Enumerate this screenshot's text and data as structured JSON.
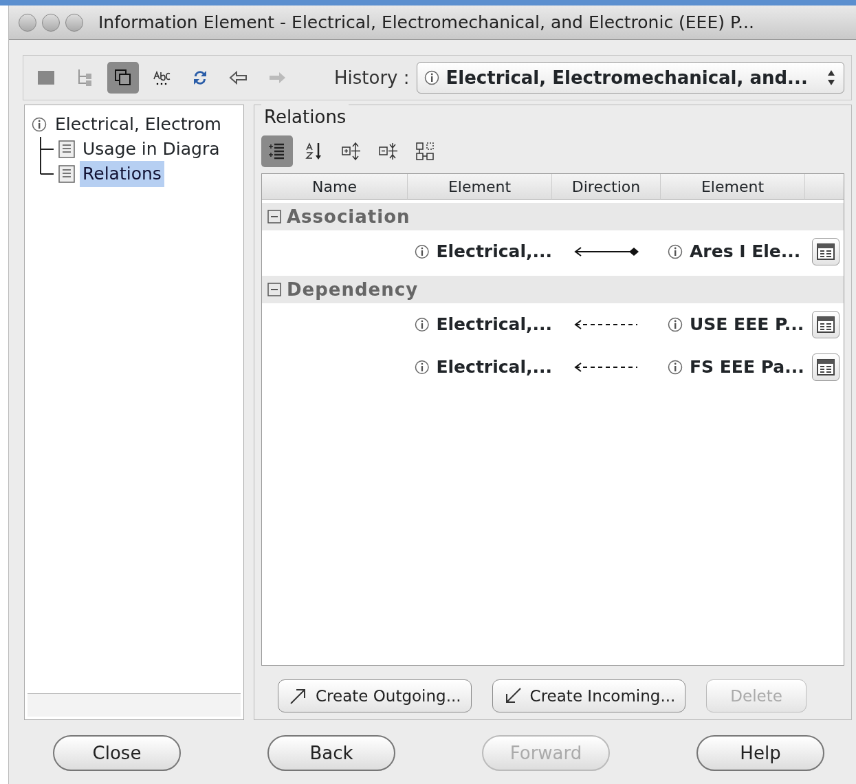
{
  "window": {
    "title": "Information Element - Electrical, Electromechanical, and Electronic (EEE) P..."
  },
  "toolbar": {
    "tools": [
      {
        "kind": "grid",
        "pressed": false
      },
      {
        "kind": "tree",
        "pressed": false
      },
      {
        "kind": "copy",
        "pressed": true
      },
      {
        "kind": "spell",
        "pressed": false
      },
      {
        "kind": "refresh",
        "pressed": false
      },
      {
        "kind": "back",
        "pressed": false
      },
      {
        "kind": "forward",
        "pressed": false
      }
    ],
    "history_label": "History :",
    "history_value": "Electrical, Electromechanical, and..."
  },
  "tree": {
    "label": "Electrical, Electrom",
    "children": [
      {
        "label": "Usage in Diagra",
        "selected": false
      },
      {
        "label": "Relations",
        "selected": true
      }
    ]
  },
  "relations": {
    "title": "Relations",
    "tools": [
      {
        "kind": "list",
        "pressed": true
      },
      {
        "kind": "sort",
        "pressed": false
      },
      {
        "kind": "expand",
        "pressed": false
      },
      {
        "kind": "collapse",
        "pressed": false
      },
      {
        "kind": "layout",
        "pressed": false
      }
    ],
    "columns": [
      "Name",
      "Element",
      "Direction",
      "Element"
    ],
    "groups": [
      {
        "name": "Association",
        "rows": [
          {
            "source": "Electrical,...",
            "kind": "association",
            "target": "Ares I Ele..."
          }
        ]
      },
      {
        "name": "Dependency",
        "rows": [
          {
            "source": "Electrical,...",
            "kind": "dependency",
            "target": "USE EEE P..."
          },
          {
            "source": "Electrical,...",
            "kind": "dependency",
            "target": "FS EEE Pa..."
          }
        ]
      }
    ],
    "buttons": [
      {
        "label": "Create Outgoing...",
        "kind": "outgoing",
        "disabled": false
      },
      {
        "label": "Create Incoming...",
        "kind": "incoming",
        "disabled": false
      },
      {
        "label": "Delete",
        "kind": "plain",
        "disabled": true
      }
    ]
  },
  "footer": [
    {
      "label": "Close",
      "disabled": false
    },
    {
      "label": "Back",
      "disabled": false
    },
    {
      "label": "Forward",
      "disabled": true
    },
    {
      "label": "Help",
      "disabled": false
    }
  ]
}
